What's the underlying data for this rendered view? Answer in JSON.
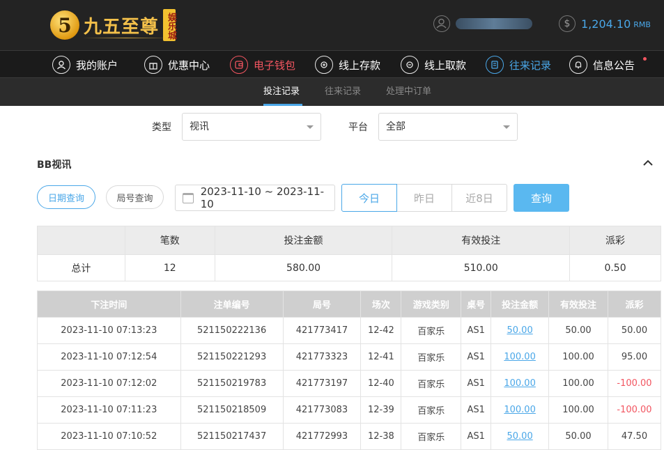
{
  "brand": {
    "logo_digit": "5",
    "name": "九五至尊",
    "badge": "娱乐城"
  },
  "user": {
    "name": "",
    "balance": "1,204.10",
    "currency": "RMB"
  },
  "nav": [
    {
      "label": "我的账户",
      "icon": "user-icon"
    },
    {
      "label": "优惠中心",
      "icon": "gift-icon"
    },
    {
      "label": "电子钱包",
      "icon": "wallet-icon"
    },
    {
      "label": "线上存款",
      "icon": "deposit-icon"
    },
    {
      "label": "线上取款",
      "icon": "withdraw-icon"
    },
    {
      "label": "往来记录",
      "icon": "records-icon"
    },
    {
      "label": "信息公告",
      "icon": "bell-icon"
    }
  ],
  "subnav": [
    "投注记录",
    "往来记录",
    "处理中订单"
  ],
  "filters": {
    "type_label": "类型",
    "type_value": "视讯",
    "platform_label": "平台",
    "platform_value": "全部"
  },
  "section_title": "BB视讯",
  "query": {
    "date_query": "日期查询",
    "round_query": "局号查询",
    "date_range": "2023-11-10 ~ 2023-11-10",
    "today": "今日",
    "yesterday": "昨日",
    "last8": "近8日",
    "submit": "查询"
  },
  "summary": {
    "headers": [
      "",
      "笔数",
      "投注金额",
      "有效投注",
      "派彩"
    ],
    "row": [
      "总计",
      "12",
      "580.00",
      "510.00",
      "0.50"
    ]
  },
  "detail": {
    "headers": [
      "下注时间",
      "注单编号",
      "局号",
      "场次",
      "游戏类别",
      "桌号",
      "投注金额",
      "有效投注",
      "派彩"
    ],
    "rows": [
      [
        "2023-11-10 07:13:23",
        "521150222136",
        "421773417",
        "12-42",
        "百家乐",
        "AS1",
        "50.00",
        "50.00",
        "50.00"
      ],
      [
        "2023-11-10 07:12:54",
        "521150221293",
        "421773323",
        "12-41",
        "百家乐",
        "AS1",
        "100.00",
        "100.00",
        "95.00"
      ],
      [
        "2023-11-10 07:12:02",
        "521150219783",
        "421773197",
        "12-40",
        "百家乐",
        "AS1",
        "100.00",
        "100.00",
        "-100.00"
      ],
      [
        "2023-11-10 07:11:23",
        "521150218509",
        "421773083",
        "12-39",
        "百家乐",
        "AS1",
        "100.00",
        "100.00",
        "-100.00"
      ],
      [
        "2023-11-10 07:10:52",
        "521150217437",
        "421772993",
        "12-38",
        "百家乐",
        "AS1",
        "50.00",
        "50.00",
        "47.50"
      ]
    ]
  },
  "colors": {
    "accent": "#4aa7e8",
    "negative": "#f25560",
    "header_bg": "#232323"
  }
}
